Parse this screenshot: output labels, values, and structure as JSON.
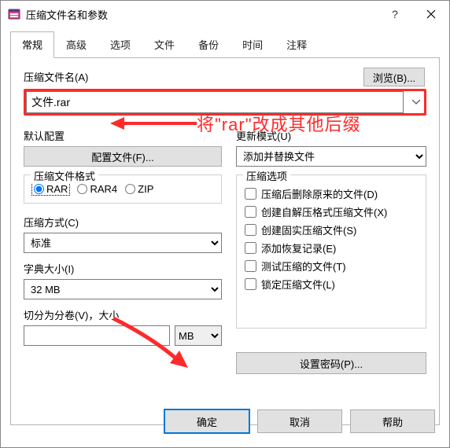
{
  "window": {
    "title": "压缩文件名和参数"
  },
  "tabs": [
    "常规",
    "高级",
    "选项",
    "文件",
    "备份",
    "时间",
    "注释"
  ],
  "archive_name": {
    "label": "压缩文件名(A)",
    "value": "文件.rar",
    "browse": "浏览(B)..."
  },
  "annotation": "将\"rar\"改成其他后缀",
  "default_profile": {
    "label": "默认配置",
    "button": "配置文件(F)..."
  },
  "update_mode": {
    "label": "更新模式(U)",
    "value": "添加并替换文件"
  },
  "format": {
    "label": "压缩文件格式",
    "options": [
      "RAR",
      "RAR4",
      "ZIP"
    ],
    "selected": "RAR"
  },
  "method": {
    "label": "压缩方式(C)",
    "value": "标准"
  },
  "dict": {
    "label": "字典大小(I)",
    "value": "32 MB"
  },
  "volume": {
    "label": "切分为分卷(V)，大小",
    "unit": "MB"
  },
  "options": {
    "label": "压缩选项",
    "items": [
      "压缩后删除原来的文件(D)",
      "创建自解压格式压缩文件(X)",
      "创建固实压缩文件(S)",
      "添加恢复记录(E)",
      "测试压缩的文件(T)",
      "锁定压缩文件(L)"
    ]
  },
  "password_btn": "设置密码(P)...",
  "footer": {
    "ok": "确定",
    "cancel": "取消",
    "help": "帮助"
  }
}
